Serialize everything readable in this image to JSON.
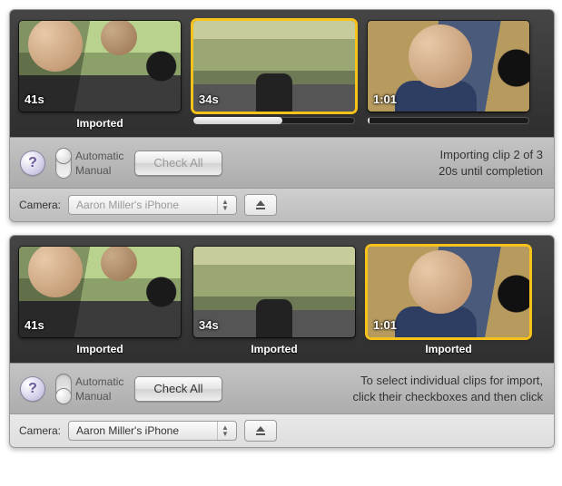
{
  "panel1": {
    "clips": [
      {
        "duration": "41s",
        "status": "Imported",
        "selected": false,
        "progress": null
      },
      {
        "duration": "34s",
        "status": "",
        "selected": true,
        "progress": 55
      },
      {
        "duration": "1:01",
        "status": "",
        "selected": false,
        "progress": 1
      }
    ],
    "toggle": {
      "top_label": "Automatic",
      "bottom_label": "Manual",
      "position": "top"
    },
    "check_all_label": "Check All",
    "check_all_enabled": false,
    "status_line1": "Importing clip 2 of 3",
    "status_line2": "20s until completion",
    "camera_label": "Camera:",
    "camera_value": "Aaron Miller's iPhone",
    "camera_enabled": false
  },
  "panel2": {
    "clips": [
      {
        "duration": "41s",
        "status": "Imported",
        "selected": false
      },
      {
        "duration": "34s",
        "status": "Imported",
        "selected": false
      },
      {
        "duration": "1:01",
        "status": "Imported",
        "selected": true
      }
    ],
    "toggle": {
      "top_label": "Automatic",
      "bottom_label": "Manual",
      "position": "bottom"
    },
    "check_all_label": "Check All",
    "check_all_enabled": true,
    "status_line1": "To select individual clips for import,",
    "status_line2": "click their checkboxes and then click",
    "camera_label": "Camera:",
    "camera_value": "Aaron Miller's iPhone",
    "camera_enabled": true
  },
  "help_glyph": "?"
}
